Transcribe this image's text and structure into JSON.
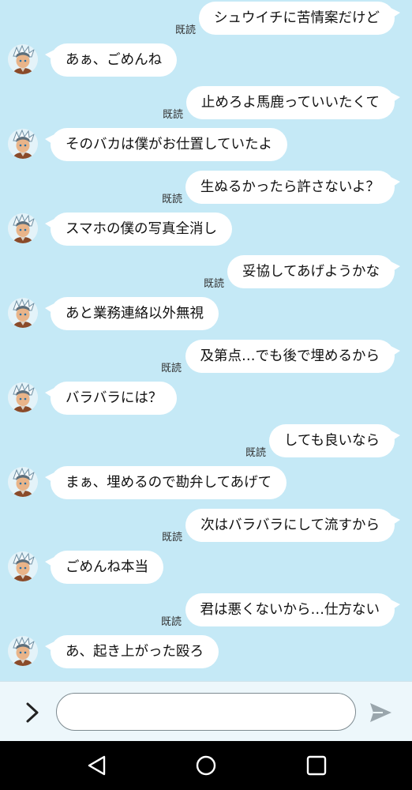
{
  "chat": {
    "read_label": "既読",
    "messages": [
      {
        "dir": "out",
        "text": "シュウイチに苦情案だけど",
        "read": true
      },
      {
        "dir": "in",
        "text": "あぁ、ごめんね"
      },
      {
        "dir": "out",
        "text": "止めろよ馬鹿っていいたくて",
        "read": true
      },
      {
        "dir": "in",
        "text": "そのバカは僕がお仕置していたよ"
      },
      {
        "dir": "out",
        "text": "生ぬるかったら許さないよ？",
        "read": true
      },
      {
        "dir": "in",
        "text": "スマホの僕の写真全消し"
      },
      {
        "dir": "out",
        "text": "妥協してあげようかな",
        "read": true
      },
      {
        "dir": "in",
        "text": "あと業務連絡以外無視"
      },
      {
        "dir": "out",
        "text": "及第点…でも後で埋めるから",
        "read": true
      },
      {
        "dir": "in",
        "text": "バラバラには？"
      },
      {
        "dir": "out",
        "text": "しても良いなら",
        "read": true
      },
      {
        "dir": "in",
        "text": "まぁ、埋めるので勘弁してあげて"
      },
      {
        "dir": "out",
        "text": "次はバラバラにして流すから",
        "read": true
      },
      {
        "dir": "in",
        "text": "ごめんね本当"
      },
      {
        "dir": "out",
        "text": "君は悪くないから…仕方ない",
        "read": true
      },
      {
        "dir": "in",
        "text": "あ、起き上がった殴ろ"
      }
    ]
  },
  "composer": {
    "input_value": "",
    "toggle_icon": "chevron-right-icon",
    "send_icon": "send-icon"
  },
  "navbar": {
    "back_icon": "back-triangle-icon",
    "home_icon": "home-circle-icon",
    "recents_icon": "recents-square-icon"
  },
  "colors": {
    "background": "#c5e9f6",
    "bubble": "#ffffff",
    "navbar": "#000000"
  }
}
